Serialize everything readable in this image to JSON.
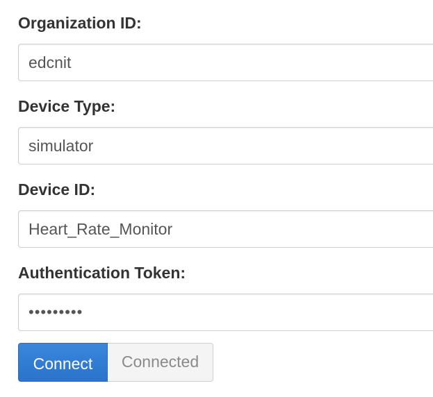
{
  "form": {
    "org_id": {
      "label": "Organization ID:",
      "value": "edcnit"
    },
    "device_type": {
      "label": "Device Type:",
      "value": "simulator"
    },
    "device_id": {
      "label": "Device ID:",
      "value": "Heart_Rate_Monitor"
    },
    "auth_token": {
      "label": "Authentication Token:",
      "value": "•••••••••"
    }
  },
  "buttons": {
    "connect_label": "Connect",
    "connected_label": "Connected"
  },
  "colors": {
    "primary": "#2f7ed8",
    "label_text": "#333333",
    "input_border": "#cfcfcf",
    "disabled_text": "#8a8a8a"
  }
}
